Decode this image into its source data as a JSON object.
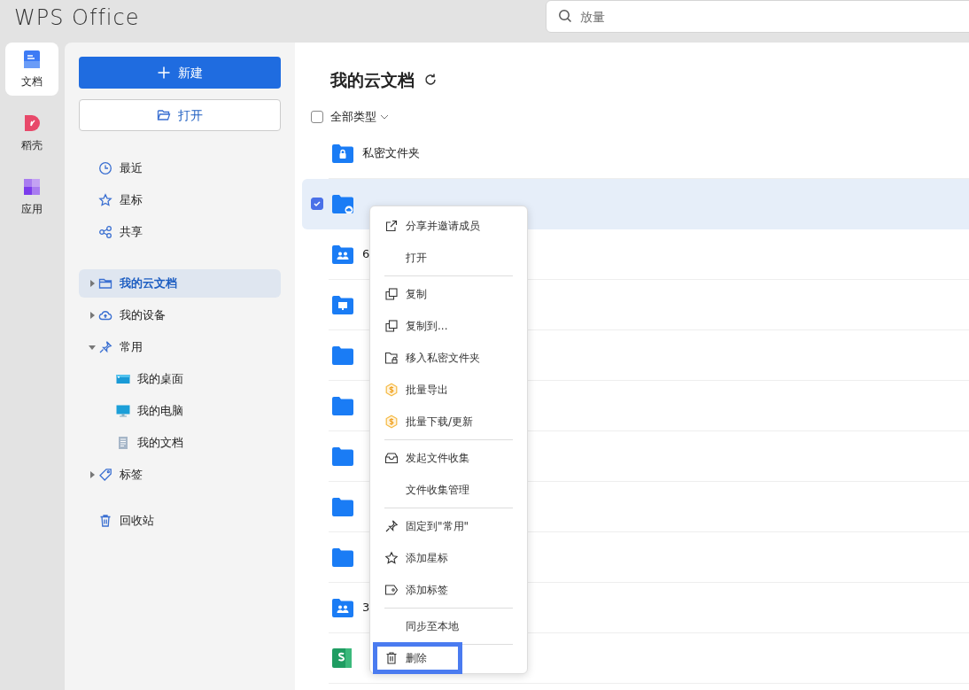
{
  "app": {
    "logo": "WPS Office"
  },
  "search": {
    "placeholder": "放量"
  },
  "rail": [
    {
      "label": "文档",
      "kind": "docs",
      "selected": true
    },
    {
      "label": "稻壳",
      "kind": "docer",
      "selected": false
    },
    {
      "label": "应用",
      "kind": "apps",
      "selected": false
    }
  ],
  "sidebar": {
    "new_button": "新建",
    "open_button": "打开",
    "quick": [
      {
        "label": "最近",
        "kind": "clock"
      },
      {
        "label": "星标",
        "kind": "star"
      },
      {
        "label": "共享",
        "kind": "share"
      }
    ],
    "tree": [
      {
        "label": "我的云文档",
        "kind": "folder",
        "selected": true,
        "expanded": false
      },
      {
        "label": "我的设备",
        "kind": "cloud",
        "selected": false,
        "expanded": false
      },
      {
        "label": "常用",
        "kind": "pin",
        "selected": false,
        "expanded": true,
        "children": [
          {
            "label": "我的桌面",
            "kind": "desktop",
            "selected": false
          },
          {
            "label": "我的电脑",
            "kind": "monitor",
            "selected": false
          },
          {
            "label": "我的文档",
            "kind": "doc",
            "selected": false
          }
        ]
      },
      {
        "label": "标签",
        "kind": "tag",
        "selected": false,
        "expanded": false
      }
    ],
    "trash": "回收站"
  },
  "main": {
    "title": "我的云文档",
    "filter": "全部类型",
    "select_all_checked": false,
    "rows": [
      {
        "name": "私密文件夹",
        "kind": "lock",
        "selected": false
      },
      {
        "kind": "cloud",
        "selected": true
      },
      {
        "name": "6",
        "kind": "team",
        "selected": false
      },
      {
        "kind": "desktop",
        "selected": false
      },
      {
        "kind": "plain",
        "selected": false
      },
      {
        "kind": "plain",
        "selected": false
      },
      {
        "kind": "plain",
        "selected": false
      },
      {
        "kind": "plain",
        "selected": false
      },
      {
        "kind": "plain",
        "selected": false
      },
      {
        "name": "3",
        "kind": "team",
        "selected": false
      },
      {
        "kind": "sheet",
        "selected": false
      }
    ]
  },
  "context_menu": [
    {
      "kind": "share",
      "label": "分享并邀请成员",
      "highlighted": false
    },
    {
      "kind": "plain",
      "label": "打开",
      "highlighted": false
    },
    {
      "kind": "separator"
    },
    {
      "kind": "copy",
      "label": "复制",
      "highlighted": false
    },
    {
      "kind": "copy",
      "label": "复制到...",
      "highlighted": false
    },
    {
      "kind": "lockfolder",
      "label": "移入私密文件夹",
      "highlighted": false
    },
    {
      "kind": "coin",
      "label": "批量导出",
      "highlighted": false
    },
    {
      "kind": "coin",
      "label": "批量下载/更新",
      "highlighted": false
    },
    {
      "kind": "separator"
    },
    {
      "kind": "inbox",
      "label": "发起文件收集",
      "highlighted": false
    },
    {
      "kind": "plain",
      "label": "文件收集管理",
      "highlighted": false
    },
    {
      "kind": "separator"
    },
    {
      "kind": "pin",
      "label": "固定到\"常用\"",
      "highlighted": false
    },
    {
      "kind": "star",
      "label": "添加星标",
      "highlighted": false
    },
    {
      "kind": "tag",
      "label": "添加标签",
      "highlighted": false
    },
    {
      "kind": "separator"
    },
    {
      "kind": "plain",
      "label": "同步至本地",
      "highlighted": false
    },
    {
      "kind": "separator"
    },
    {
      "kind": "trash",
      "label": "删除",
      "highlighted": true
    }
  ]
}
